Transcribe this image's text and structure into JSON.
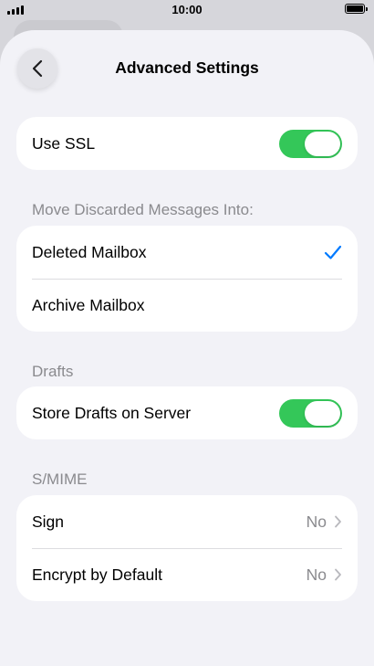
{
  "status_bar": {
    "time": "10:00"
  },
  "header": {
    "title": "Advanced Settings"
  },
  "ssl": {
    "label": "Use SSL",
    "enabled": true
  },
  "move_discarded": {
    "header": "Move Discarded Messages Into:",
    "options": [
      {
        "label": "Deleted Mailbox",
        "selected": true
      },
      {
        "label": "Archive Mailbox",
        "selected": false
      }
    ]
  },
  "drafts": {
    "header": "Drafts",
    "store_label": "Store Drafts on Server",
    "enabled": true
  },
  "smime": {
    "header": "S/MIME",
    "rows": [
      {
        "label": "Sign",
        "value": "No"
      },
      {
        "label": "Encrypt by Default",
        "value": "No"
      }
    ]
  },
  "colors": {
    "accent": "#007aff",
    "toggle_on": "#34c759",
    "background": "#f2f2f7"
  }
}
